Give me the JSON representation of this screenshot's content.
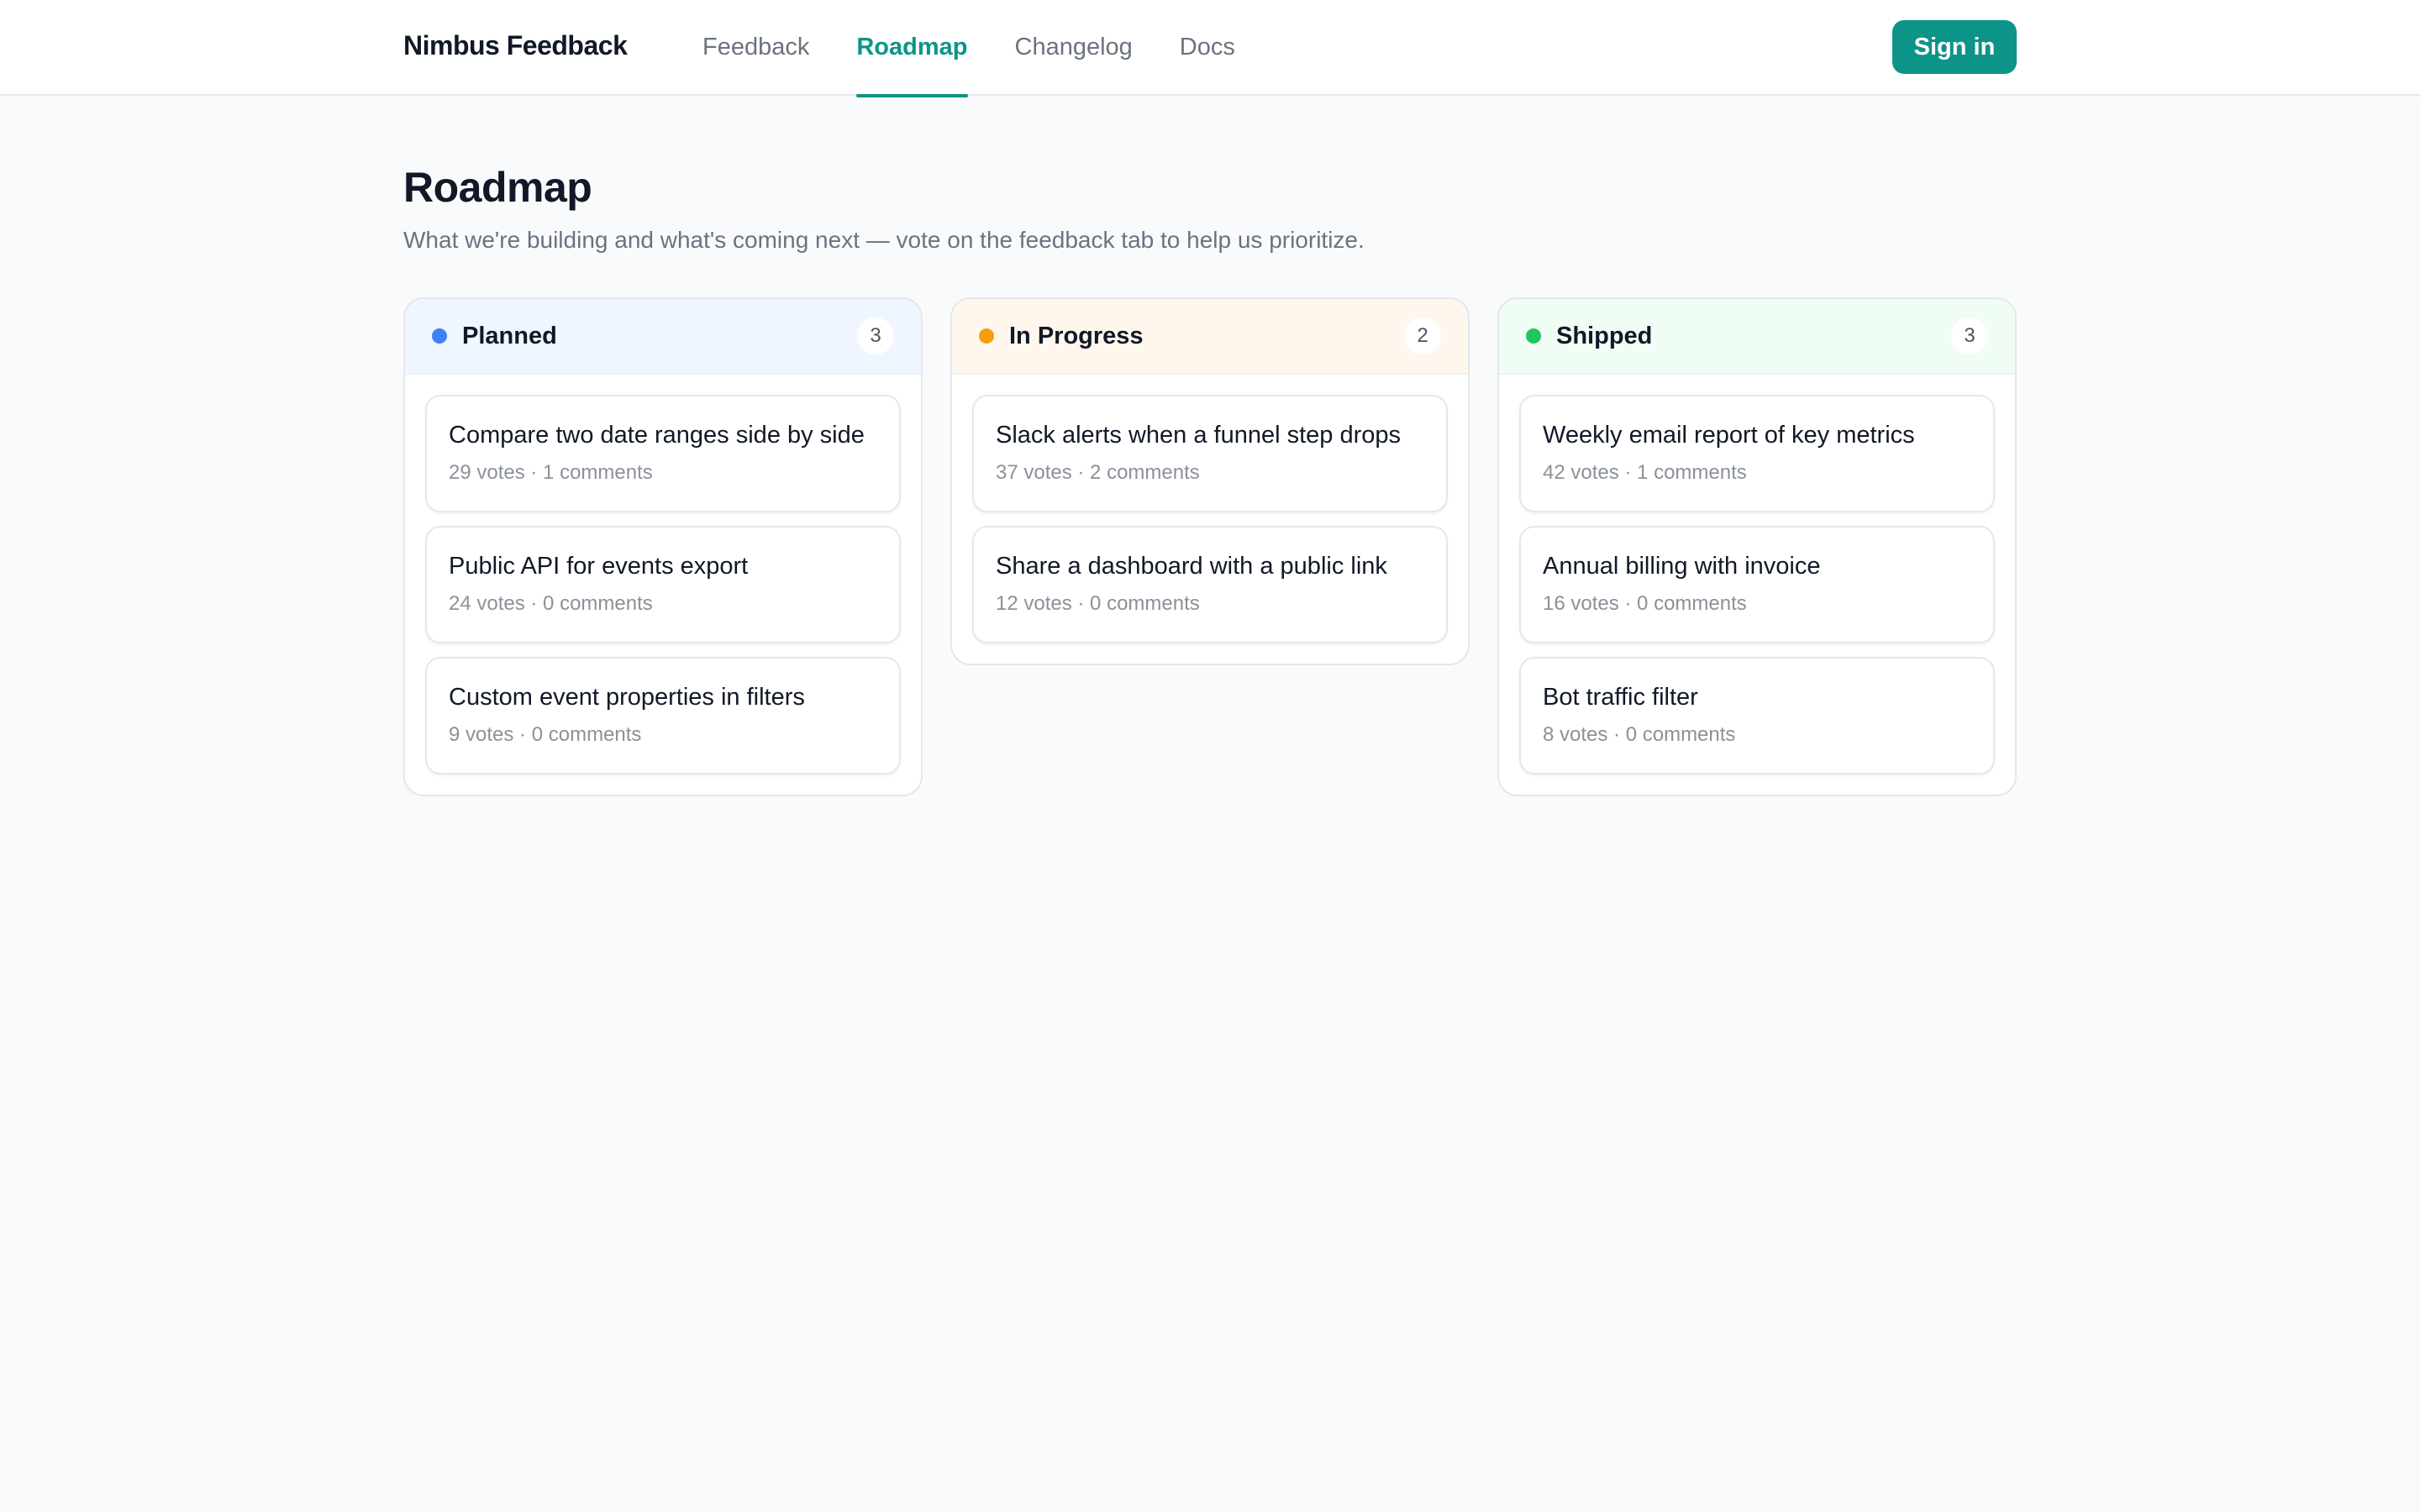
{
  "header": {
    "brand": "Nimbus Feedback",
    "nav": [
      {
        "label": "Feedback",
        "active": false
      },
      {
        "label": "Roadmap",
        "active": true
      },
      {
        "label": "Changelog",
        "active": false
      },
      {
        "label": "Docs",
        "active": false
      }
    ],
    "signin_label": "Sign in",
    "accent_color": "#0d9488"
  },
  "page": {
    "title": "Roadmap",
    "subtitle": "What we're building and what's coming next — vote on the feedback tab to help us prioritize."
  },
  "columns": [
    {
      "title": "Planned",
      "count": "3",
      "dot_color": "#3b82f6",
      "header_bg": "#eff6ff",
      "cards": [
        {
          "title": "Compare two date ranges side by side",
          "meta": "29 votes · 1 comments"
        },
        {
          "title": "Public API for events export",
          "meta": "24 votes · 0 comments"
        },
        {
          "title": "Custom event properties in filters",
          "meta": "9 votes · 0 comments"
        }
      ]
    },
    {
      "title": "In Progress",
      "count": "2",
      "dot_color": "#f59e0b",
      "header_bg": "#fff7ed",
      "cards": [
        {
          "title": "Slack alerts when a funnel step drops",
          "meta": "37 votes · 2 comments"
        },
        {
          "title": "Share a dashboard with a public link",
          "meta": "12 votes · 0 comments"
        }
      ]
    },
    {
      "title": "Shipped",
      "count": "3",
      "dot_color": "#22c55e",
      "header_bg": "#f0fdf4",
      "cards": [
        {
          "title": "Weekly email report of key metrics",
          "meta": "42 votes · 1 comments"
        },
        {
          "title": "Annual billing with invoice",
          "meta": "16 votes · 0 comments"
        },
        {
          "title": "Bot traffic filter",
          "meta": "8 votes · 0 comments"
        }
      ]
    }
  ]
}
